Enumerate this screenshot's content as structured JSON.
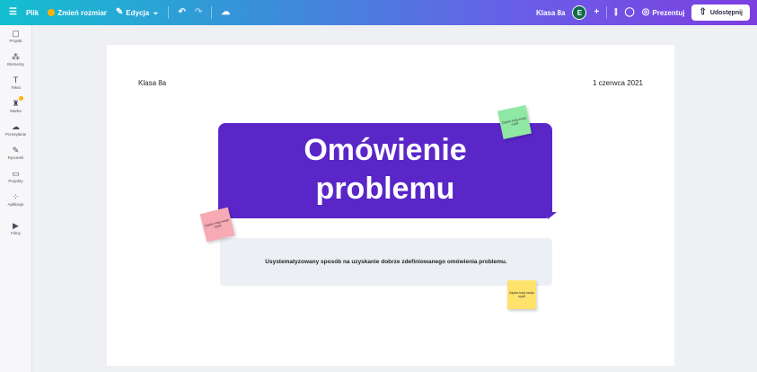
{
  "topbar": {
    "file": "Plik",
    "resize": "Zmień rozmiar",
    "edit": "Edycja",
    "doc_title": "Klasa 8a",
    "avatar_letter": "E",
    "present": "Prezentuj",
    "share": "Udostępnij"
  },
  "sidebar": {
    "items": [
      {
        "label": "Projekt",
        "icon": "▢"
      },
      {
        "label": "Elementy",
        "icon": "⁂"
      },
      {
        "label": "Tekst",
        "icon": "T"
      },
      {
        "label": "Marka",
        "icon": "♜"
      },
      {
        "label": "Przesyłanie",
        "icon": "☁"
      },
      {
        "label": "Rysunek",
        "icon": "✎"
      },
      {
        "label": "Projekty",
        "icon": "▭"
      },
      {
        "label": "Aplikacje",
        "icon": "⁘"
      },
      {
        "label": "Filmy",
        "icon": "▶"
      }
    ]
  },
  "slide": {
    "class_label": "Klasa 8a",
    "date": "1 czerwca 2021",
    "title_line1": "Omówienie",
    "title_line2": "problemu",
    "subtitle": "Usystematyzowany sposób na uzyskanie dobrze zdefiniowanego omówienia problemu.",
    "sticky_text": "Zapisz tutaj swoje myśli"
  }
}
